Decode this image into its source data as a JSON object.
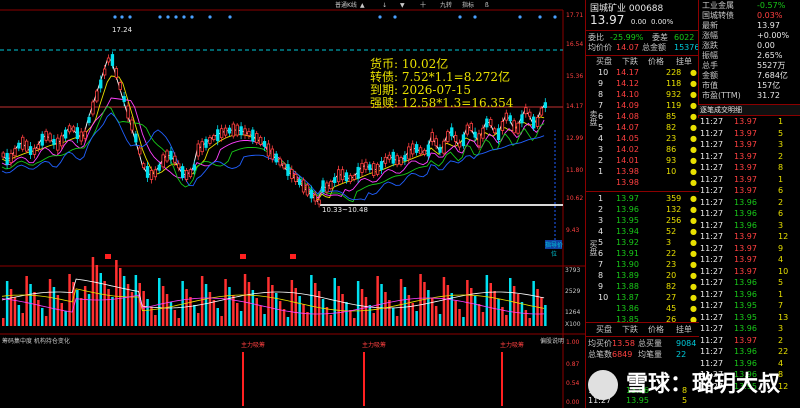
{
  "stock": {
    "name": "国城矿业",
    "code": "000688",
    "price": "13.97",
    "change": "0.00",
    "change_pct": "0.00%"
  },
  "top_tabs": [
    "普通K线",
    "▲",
    "↓",
    "▼",
    "十",
    "九转",
    "指标",
    "ß"
  ],
  "price_axis": [
    "17.71",
    "16.54",
    "15.36",
    "14.17",
    "12.99",
    "11.80",
    "10.62",
    "9.43"
  ],
  "volume_axis": [
    "3793",
    "2529",
    "1264",
    "X100"
  ],
  "volume_labels": [
    "成交量",
    "VOL: ..."
  ],
  "indicator_panel": {
    "title_left": "筹码集中度  机构持仓变化",
    "label_right": "偏股说明",
    "axis": [
      "1.00",
      "0.87",
      "0.54",
      "0.00"
    ],
    "spike_label": "主力吸筹"
  },
  "annotations": {
    "high": "17.24",
    "low": "10.33~10.48",
    "lines": [
      "货币: 10.02亿",
      "转债: 7.52*1.1=8.272亿",
      "到期: 2026-07-15",
      "强赎: 12.58*1.3=16.354"
    ],
    "tag_right": "指导价位"
  },
  "panel": {
    "header": [
      "委比",
      "-25.99%",
      "委差",
      "6022"
    ],
    "avg_label": "均价价",
    "avg_value": "14.07",
    "total_label": "总金额",
    "total_value": "15376",
    "col_headers": [
      "买盘",
      "下跌",
      "价格",
      "挂单"
    ],
    "sell_side_label": "卖盘",
    "sell": [
      [
        "10",
        "14.17",
        "228",
        "●"
      ],
      [
        "9",
        "14.12",
        "118",
        "●"
      ],
      [
        "8",
        "14.10",
        "932",
        "●"
      ],
      [
        "7",
        "14.09",
        "119",
        "●"
      ],
      [
        "6",
        "14.08",
        "85",
        "●"
      ],
      [
        "5",
        "14.07",
        "82",
        "●"
      ],
      [
        "4",
        "14.05",
        "23",
        "●"
      ],
      [
        "3",
        "14.02",
        "86",
        "●"
      ],
      [
        "2",
        "14.01",
        "93",
        "●"
      ],
      [
        "1",
        "13.98",
        "10",
        "●"
      ],
      [
        "",
        "13.98",
        "",
        "●"
      ]
    ],
    "buy_side_label": "买盘",
    "buy": [
      [
        "1",
        "13.97",
        "359",
        "●"
      ],
      [
        "2",
        "13.96",
        "132",
        "●"
      ],
      [
        "3",
        "13.95",
        "256",
        "●"
      ],
      [
        "4",
        "13.94",
        "52",
        "●"
      ],
      [
        "5",
        "13.92",
        "3",
        "●"
      ],
      [
        "6",
        "13.91",
        "22",
        "●"
      ],
      [
        "7",
        "13.90",
        "23",
        "●"
      ],
      [
        "8",
        "13.89",
        "20",
        "●"
      ],
      [
        "9",
        "13.88",
        "82",
        "●"
      ],
      [
        "10",
        "13.87",
        "27",
        "●"
      ],
      [
        "",
        "13.86",
        "45",
        "●"
      ],
      [
        "",
        "13.85",
        "26",
        "●"
      ]
    ],
    "footer": [
      [
        "均买价",
        "13.58",
        "总买量",
        "9084"
      ],
      [
        "总笔数",
        "6849",
        "均笔量",
        "22"
      ]
    ],
    "time_rows": [
      [
        "11:27",
        "13.96",
        "8"
      ],
      [
        "11:27",
        "13.95",
        "5"
      ]
    ]
  },
  "stats": [
    [
      "工业金属",
      "-0.57%"
    ],
    [
      "国城转债",
      "0.03%"
    ],
    [
      "最新",
      "13.97"
    ],
    [
      "涨幅",
      "+0.00%"
    ],
    [
      "涨跌",
      "0.00"
    ],
    [
      "振幅",
      "2.65%"
    ],
    [
      "总手",
      "5527万"
    ],
    [
      "金额",
      "7.684亿"
    ],
    [
      "市值",
      "157亿"
    ],
    [
      "市盈(TTM)",
      "31.72"
    ]
  ],
  "ticks_header": "逐笔成交明细",
  "ticks": [
    [
      "11:27",
      "13.97",
      "1"
    ],
    [
      "11:27",
      "13.97",
      "5"
    ],
    [
      "11:27",
      "13.97",
      "3"
    ],
    [
      "11:27",
      "13.97",
      "2"
    ],
    [
      "11:27",
      "13.97",
      "8"
    ],
    [
      "11:27",
      "13.97",
      "1"
    ],
    [
      "11:27",
      "13.97",
      "6"
    ],
    [
      "11:27",
      "13.96",
      "2"
    ],
    [
      "11:27",
      "13.96",
      "6"
    ],
    [
      "11:27",
      "13.96",
      "3"
    ],
    [
      "11:27",
      "13.97",
      "12"
    ],
    [
      "11:27",
      "13.97",
      "9"
    ],
    [
      "11:27",
      "13.97",
      "4"
    ],
    [
      "11:27",
      "13.97",
      "10"
    ],
    [
      "11:27",
      "13.96",
      "5"
    ],
    [
      "11:27",
      "13.96",
      "1"
    ],
    [
      "11:27",
      "13.95",
      "7"
    ],
    [
      "11:27",
      "13.95",
      "13"
    ],
    [
      "11:27",
      "13.96",
      "3"
    ],
    [
      "11:27",
      "13.97",
      "2"
    ],
    [
      "11:27",
      "13.96",
      "22"
    ],
    [
      "11:27",
      "13.96",
      "4"
    ],
    [
      "11:27",
      "13.96",
      "8"
    ],
    [
      "11:27",
      "13.95",
      "12"
    ]
  ],
  "watermark": "雪球：璐玥大叔"
}
